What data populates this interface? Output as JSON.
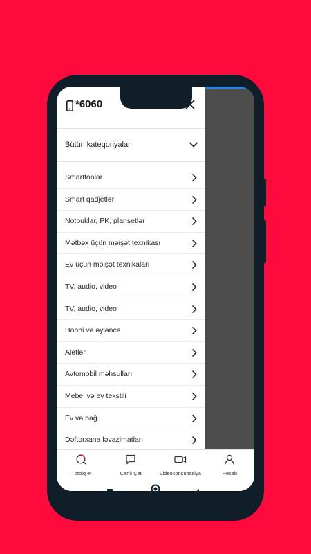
{
  "colors": {
    "background": "#FF0A3D",
    "phone_frame": "#0F1E29",
    "overlay": "#4D4D4D",
    "accent_blue": "#1E88E5"
  },
  "header": {
    "hotline": "*6060",
    "icon_left": "smartphone-icon",
    "icon_close": "close-icon"
  },
  "all_categories": {
    "label": "Bütün kateqoriyalar",
    "icon": "chevron-down-icon"
  },
  "categories": [
    {
      "label": "Smartfonlar"
    },
    {
      "label": "Smart qadjetlər"
    },
    {
      "label": "Notbuklar, PK, planşetlər"
    },
    {
      "label": "Mətbəx üçün məişət texnikası"
    },
    {
      "label": "Ev üçün məişət texnikaları"
    },
    {
      "label": "TV, audio, video"
    },
    {
      "label": "TV, audio, video"
    },
    {
      "label": "Hobbi və əyləncə"
    },
    {
      "label": "Alətlər"
    },
    {
      "label": "Avtomobil məhsulları"
    },
    {
      "label": "Mebel və ev tekstili"
    },
    {
      "label": "Ev və bağ"
    },
    {
      "label": "Dəftərxana ləvazimatları"
    }
  ],
  "bottom_nav": [
    {
      "label": "Tətbiq et",
      "icon": "apply-icon"
    },
    {
      "label": "Canlı Çat",
      "icon": "chat-icon"
    },
    {
      "label": "Videokonsultasiya",
      "icon": "video-icon"
    },
    {
      "label": "Hesab",
      "icon": "account-icon"
    }
  ]
}
